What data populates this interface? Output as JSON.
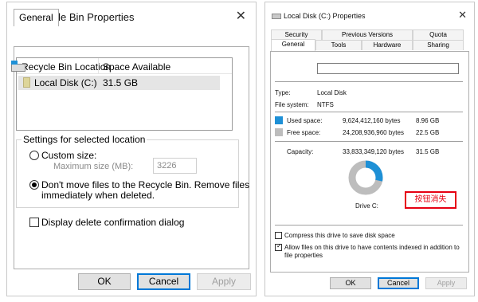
{
  "left": {
    "title": "Recycle Bin Properties",
    "close_glyph": "✕",
    "tab": "General",
    "list": {
      "col1": "Recycle Bin Location",
      "col2": "Space Available",
      "rows": [
        {
          "location": "Local Disk (C:)",
          "space": "31.5 GB"
        }
      ]
    },
    "group_label": "Settings for selected location",
    "custom_size_label": "Custom size:",
    "max_size_label": "Maximum size (MB):",
    "max_size_value": "3226",
    "dont_move_label_line1": "Don't move files to the Recycle Bin. Remove files",
    "dont_move_label_line2": "immediately when deleted.",
    "display_confirm_label": "Display delete confirmation dialog",
    "buttons": {
      "ok": "OK",
      "cancel": "Cancel",
      "apply": "Apply"
    }
  },
  "right": {
    "title": "Local Disk (C:) Properties",
    "close_glyph": "✕",
    "tabs_row1": [
      "Security",
      "Previous Versions",
      "Quota"
    ],
    "tabs_row2": [
      "General",
      "Tools",
      "Hardware",
      "Sharing"
    ],
    "type_label": "Type:",
    "type_value": "Local Disk",
    "fs_label": "File system:",
    "fs_value": "NTFS",
    "used_label": "Used space:",
    "used_bytes": "9,624,412,160 bytes",
    "used_gb": "8.96 GB",
    "free_label": "Free space:",
    "free_bytes": "24,208,936,960 bytes",
    "free_gb": "22.5 GB",
    "capacity_label": "Capacity:",
    "capacity_bytes": "33,833,349,120 bytes",
    "capacity_gb": "31.5 GB",
    "drive_label": "Drive C:",
    "annotation": "按钮消失",
    "compress_label": "Compress this drive to save disk space",
    "index_label_line1": "Allow files on this drive to have contents indexed in addition to",
    "index_label_line2": "file properties",
    "buttons": {
      "ok": "OK",
      "cancel": "Cancel",
      "apply": "Apply"
    },
    "colors": {
      "used": "#1e90d6",
      "free": "#bdbdbd",
      "annotation": "#e60012"
    },
    "usage_fraction": 0.2845
  }
}
